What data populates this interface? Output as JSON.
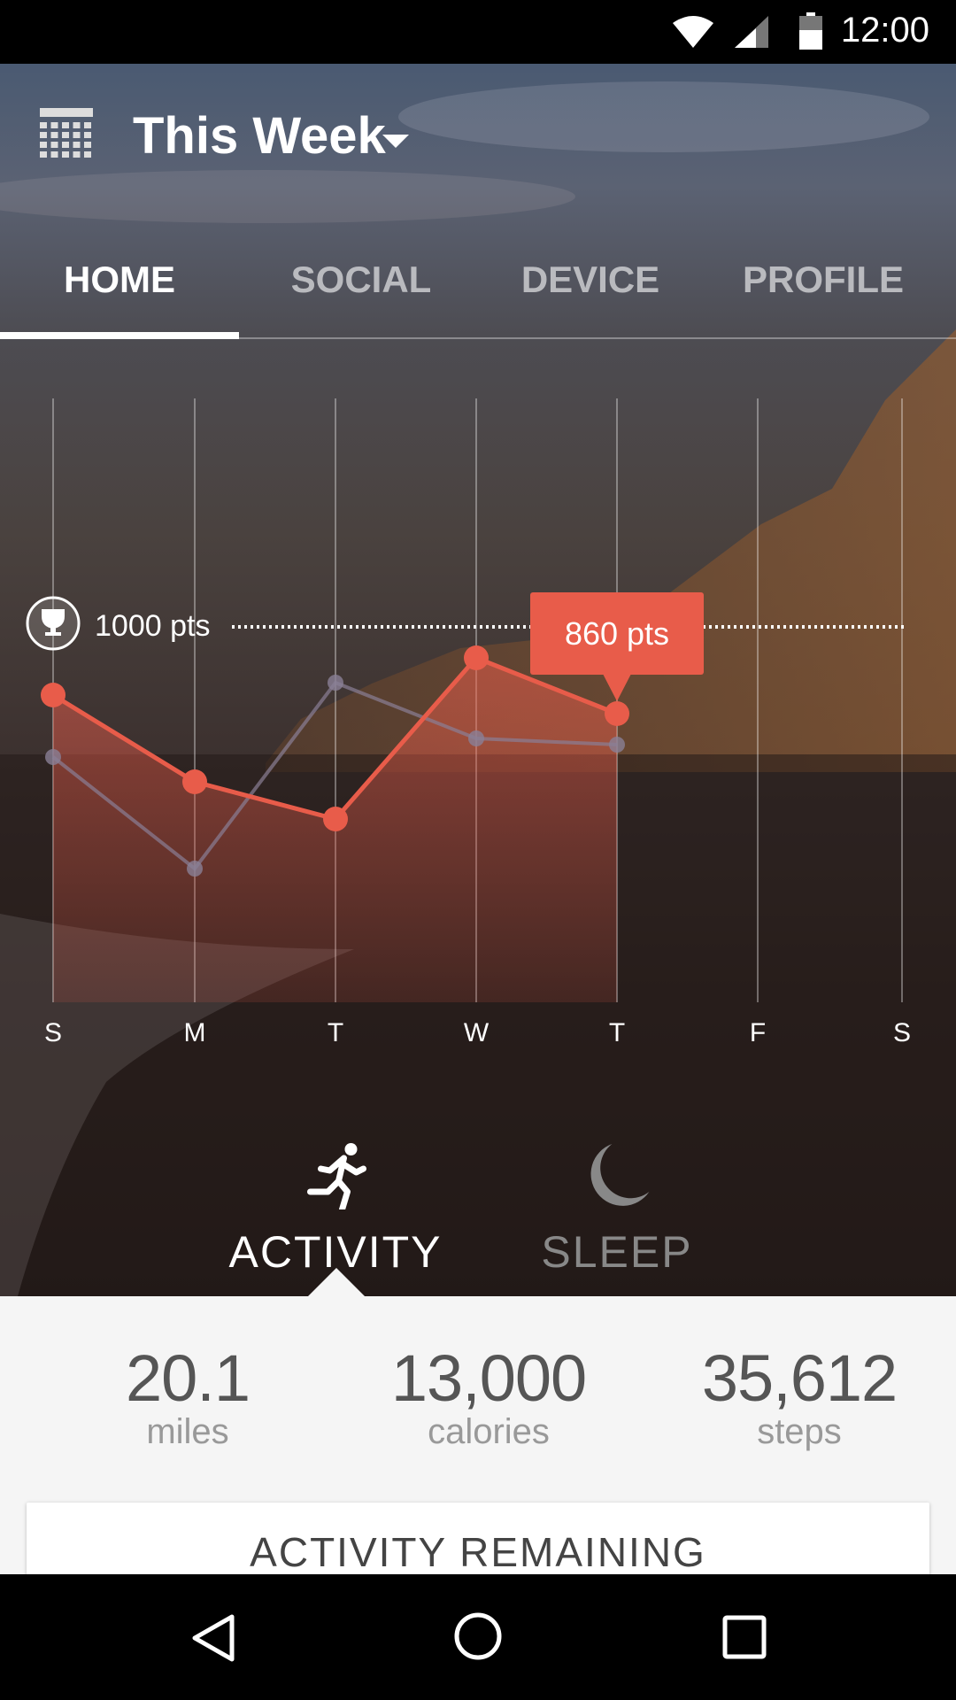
{
  "status_bar": {
    "time": "12:00",
    "icons": [
      "wifi-icon",
      "signal-icon",
      "battery-icon"
    ]
  },
  "header": {
    "title": "This Week",
    "icon": "calendar-icon"
  },
  "tabs": [
    {
      "label": "HOME",
      "active": true
    },
    {
      "label": "SOCIAL"
    },
    {
      "label": "DEVICE"
    },
    {
      "label": "PROFILE"
    }
  ],
  "chart_data": {
    "type": "line",
    "categories": [
      "S",
      "M",
      "T",
      "W",
      "T",
      "F",
      "S"
    ],
    "goal": {
      "value": 1000,
      "label": "1000 pts"
    },
    "tooltip": {
      "label": "860 pts",
      "index": 4
    },
    "series": [
      {
        "values": [
          890,
          750,
          690,
          950,
          860
        ],
        "color": "#e85c4a"
      },
      {
        "values": [
          790,
          610,
          910,
          820,
          810
        ],
        "color": "#8a7f96"
      }
    ],
    "accent": "#e85c4a"
  },
  "segments": [
    {
      "label": "ACTIVITY",
      "icon": "running-icon",
      "active": true
    },
    {
      "label": "SLEEP",
      "icon": "moon-icon"
    }
  ],
  "stats": [
    {
      "value": "20.1",
      "unit": "miles"
    },
    {
      "value": "13,000",
      "unit": "calories"
    },
    {
      "value": "35,612",
      "unit": "steps"
    }
  ],
  "card": {
    "title": "ACTIVITY REMAINING"
  }
}
